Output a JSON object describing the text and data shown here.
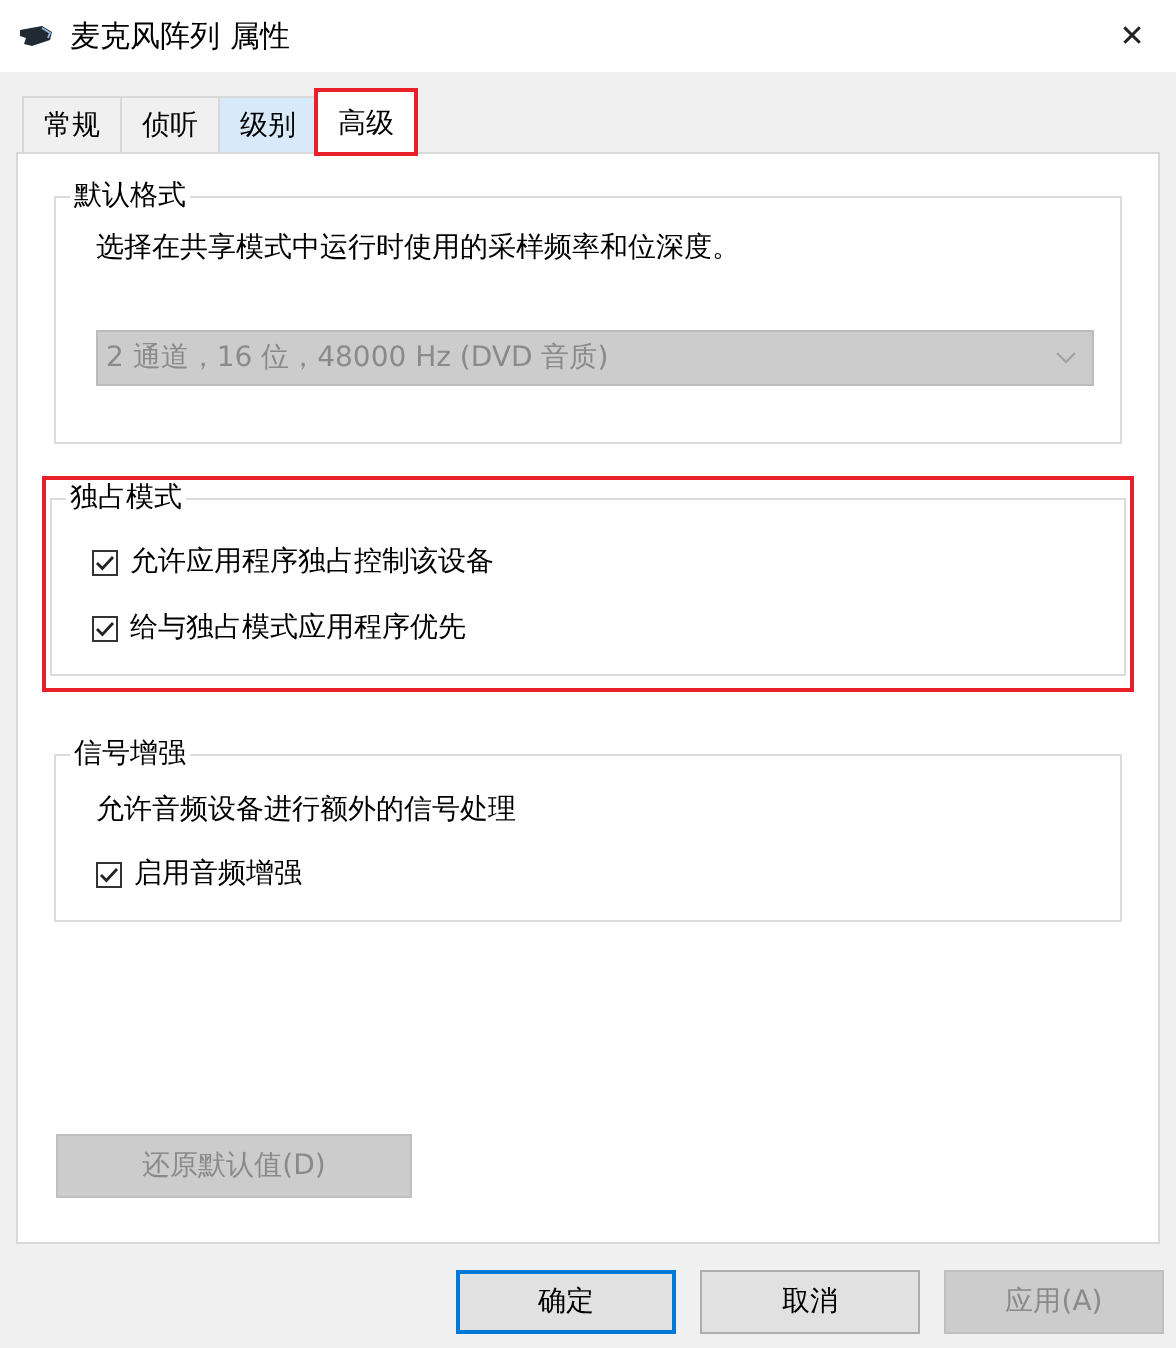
{
  "window": {
    "title": "麦克风阵列 属性",
    "close_glyph": "✕"
  },
  "tabs": [
    {
      "label": "常规",
      "selected": false,
      "hovered": false,
      "highlighted": false
    },
    {
      "label": "侦听",
      "selected": false,
      "hovered": false,
      "highlighted": false
    },
    {
      "label": "级别",
      "selected": false,
      "hovered": true,
      "highlighted": false
    },
    {
      "label": "高级",
      "selected": true,
      "hovered": false,
      "highlighted": true
    }
  ],
  "groups": [
    {
      "kind": "format",
      "title": "默认格式",
      "highlighted": false,
      "description": "选择在共享模式中运行时使用的采样频率和位深度。",
      "dropdown": {
        "value": "2 通道，16 位，48000 Hz (DVD 音质)",
        "disabled": true
      }
    },
    {
      "kind": "checks",
      "title": "独占模式",
      "highlighted": true,
      "options": [
        {
          "label": "允许应用程序独占控制该设备",
          "checked": true
        },
        {
          "label": "给与独占模式应用程序优先",
          "checked": true
        }
      ]
    },
    {
      "kind": "enhance",
      "title": "信号增强",
      "highlighted": false,
      "description": "允许音频设备进行额外的信号处理",
      "options": [
        {
          "label": "启用音频增强",
          "checked": true
        }
      ]
    }
  ],
  "restore_button": {
    "label": "还原默认值(D)",
    "disabled": true
  },
  "buttons": [
    {
      "label": "确定",
      "default": true,
      "disabled": false
    },
    {
      "label": "取消",
      "default": false,
      "disabled": false
    },
    {
      "label": "应用(A)",
      "default": false,
      "disabled": true
    }
  ]
}
